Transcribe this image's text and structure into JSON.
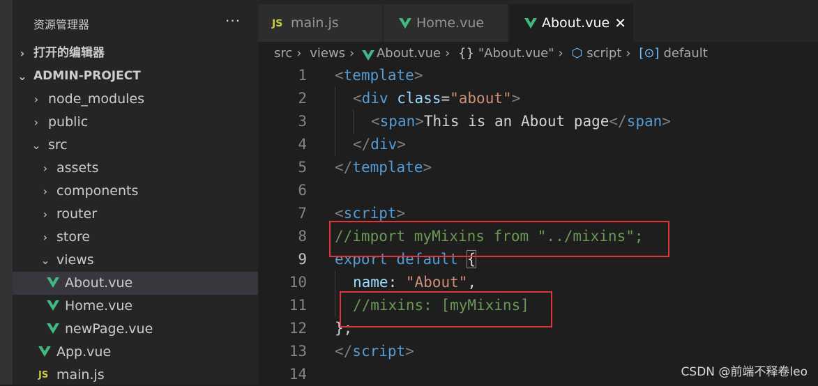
{
  "explorer": {
    "title": "资源管理器",
    "more": "···",
    "open_editors": "打开的编辑器",
    "project": "ADMIN-PROJECT",
    "tree": [
      {
        "label": "node_modules",
        "type": "folder",
        "expanded": false
      },
      {
        "label": "public",
        "type": "folder",
        "expanded": false
      },
      {
        "label": "src",
        "type": "folder",
        "expanded": true
      },
      {
        "label": "assets",
        "type": "folder",
        "expanded": false
      },
      {
        "label": "components",
        "type": "folder",
        "expanded": false
      },
      {
        "label": "router",
        "type": "folder",
        "expanded": false
      },
      {
        "label": "store",
        "type": "folder",
        "expanded": false
      },
      {
        "label": "views",
        "type": "folder",
        "expanded": true
      },
      {
        "label": "About.vue",
        "type": "vue",
        "selected": true
      },
      {
        "label": "Home.vue",
        "type": "vue"
      },
      {
        "label": "newPage.vue",
        "type": "vue"
      },
      {
        "label": "App.vue",
        "type": "vue"
      },
      {
        "label": "main.js",
        "type": "js",
        "icon_text": "JS"
      }
    ]
  },
  "tabs": [
    {
      "label": "main.js",
      "icon": "js-icon",
      "icon_text": "JS",
      "active": false
    },
    {
      "label": "Home.vue",
      "icon": "vue-icon",
      "active": false
    },
    {
      "label": "About.vue",
      "icon": "vue-icon",
      "active": true,
      "close": "✕"
    }
  ],
  "breadcrumb": {
    "parts": [
      "src",
      "views",
      "About.vue",
      "\"About.vue\"",
      "script",
      "default"
    ],
    "braces": "{}",
    "sep": "›"
  },
  "editor": {
    "line_numbers": [
      "1",
      "2",
      "3",
      "4",
      "5",
      "6",
      "7",
      "8",
      "9",
      "10",
      "11",
      "12",
      "13",
      "14"
    ],
    "current_line": "9",
    "lines": {
      "l1_open": "<",
      "l1_tag": "template",
      "l1_close": ">",
      "l2_open": "<",
      "l2_tag": "div",
      "l2_attr": "class",
      "l2_eq": "=",
      "l2_val": "\"about\"",
      "l2_close": ">",
      "l3_open": "<",
      "l3_tag": "span",
      "l3_close": ">",
      "l3_text": "This is an About page",
      "l3_end_open": "</",
      "l3_end_tag": "span",
      "l3_end_close": ">",
      "l4_open": "</",
      "l4_tag": "div",
      "l4_close": ">",
      "l5_open": "</",
      "l5_tag": "template",
      "l5_close": ">",
      "l7_open": "<",
      "l7_tag": "script",
      "l7_close": ">",
      "l8_comment": "//import myMixins from \"../mixins\";",
      "l9_kw1": "export",
      "l9_kw2": "default",
      "l9_brace": "{",
      "l10_prop": "name",
      "l10_colon": ": ",
      "l10_str": "\"About\"",
      "l10_comma": ",",
      "l11_comment": "//mixins: [myMixins]",
      "l12_text": "};",
      "l13_open": "</",
      "l13_tag": "script",
      "l13_close": ">"
    }
  },
  "watermark": "CSDN @前端不释卷leo",
  "colors": {
    "highlight_box": "#e0353b",
    "vue_green": "#41b883",
    "js_yellow": "#cbcb41"
  }
}
